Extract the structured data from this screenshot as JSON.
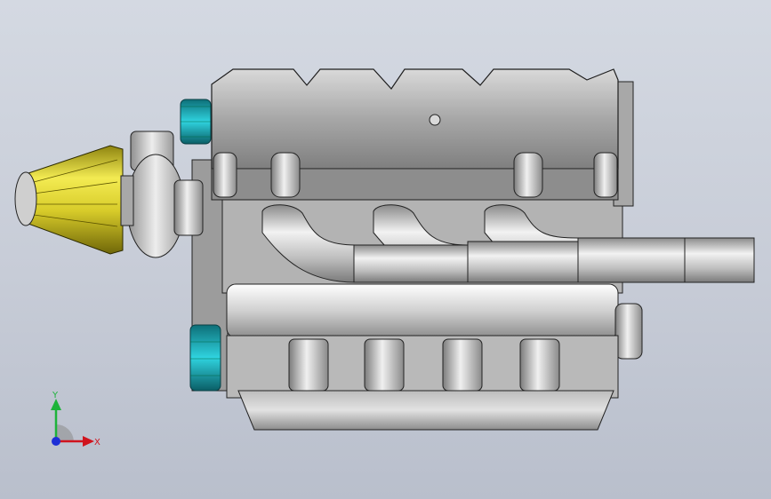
{
  "viewport": {
    "background_top": "#d4d9e2",
    "background_bottom": "#b9bfcc"
  },
  "model": {
    "air_filter_color": "#d8cc2a",
    "pulley_color": "#22b4c2",
    "metal_color": "#a9a9a9"
  },
  "triad": {
    "y_label": "Y",
    "x_label": "X",
    "y_color": "#1db33a",
    "x_color": "#d0141e",
    "z_color": "#1d2fd6"
  }
}
